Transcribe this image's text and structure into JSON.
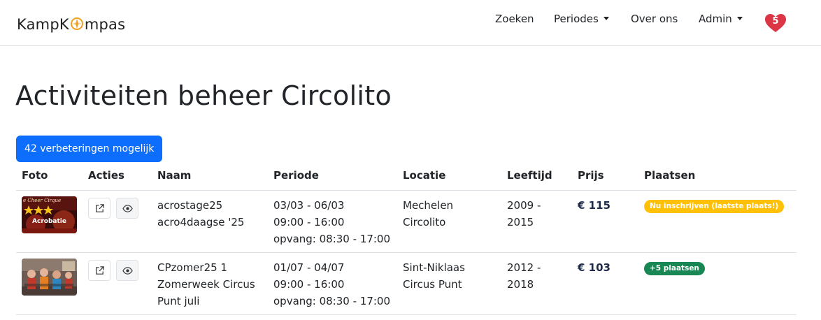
{
  "brand": {
    "part1": "KampK",
    "part2": "mpas"
  },
  "nav": {
    "search": "Zoeken",
    "periods": "Periodes",
    "about": "Over ons",
    "admin": "Admin",
    "favorites_count": "5"
  },
  "page": {
    "title": "Activiteiten beheer Circolito",
    "improvements_button": "42 verbeteringen mogelijk"
  },
  "table": {
    "headers": [
      "Foto",
      "Acties",
      "Naam",
      "Periode",
      "Locatie",
      "Leeftijd",
      "Prijs",
      "Plaatsen"
    ],
    "rows": [
      {
        "photo_label": "Acrobatie",
        "photo_banner": "e Cheer Cirque",
        "name": [
          "acrostage25",
          "acro4daagse '25"
        ],
        "period": [
          "03/03 - 06/03",
          "09:00 - 16:00",
          "opvang: 08:30 - 17:00"
        ],
        "location": [
          "Mechelen",
          "Circolito"
        ],
        "age": [
          "2009 -",
          "2015"
        ],
        "price": "€ 115",
        "places": "Nu inschrijven (laatste plaats!)",
        "places_status": "warning"
      },
      {
        "name": [
          "CPzomer25 1",
          "Zomerweek Circus",
          "Punt juli"
        ],
        "period": [
          "01/07 - 04/07",
          "09:00 - 16:00",
          "opvang: 08:30 - 17:00"
        ],
        "location": [
          "Sint-Niklaas",
          "Circus Punt"
        ],
        "age": [
          "2012 -",
          "2018"
        ],
        "price": "€ 103",
        "places": "+5 plaatsen",
        "places_status": "success"
      }
    ]
  },
  "colors": {
    "primary": "#0d6efd",
    "warning": "#ffc107",
    "success": "#198754",
    "heart": "#dc3545"
  },
  "icons": [
    "compass-icon",
    "caret-down-icon",
    "heart-icon",
    "external-link-icon",
    "eye-icon"
  ]
}
